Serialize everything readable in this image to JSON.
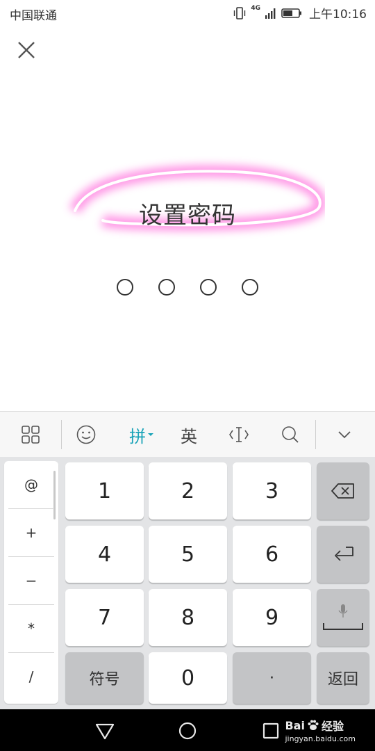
{
  "status_bar": {
    "carrier": "中国联通",
    "network": "4G",
    "time": "上午10:16"
  },
  "dialog": {
    "title": "设置密码",
    "pin_length": 4,
    "pin_entered": 0
  },
  "keyboard": {
    "toolbar": {
      "pinyin_label": "拼",
      "english_label": "英"
    },
    "symbols": [
      "@",
      "+",
      "−",
      "*",
      "/"
    ],
    "keys": {
      "k1": "1",
      "k2": "2",
      "k3": "3",
      "k4": "4",
      "k5": "5",
      "k6": "6",
      "k7": "7",
      "k8": "8",
      "k9": "9",
      "symbols_label": "符号",
      "k0": "0",
      "dot": "·",
      "return_label": "返回"
    }
  },
  "watermark": {
    "brand": "Bai",
    "brand_suffix": "经验",
    "url": "jingyan.baidu.com"
  },
  "colors": {
    "accent": "#1aa3b8",
    "highlight_glow": "#ff7fe0",
    "key_gray": "#c3c4c6",
    "keyboard_bg": "#e3e4e6"
  }
}
